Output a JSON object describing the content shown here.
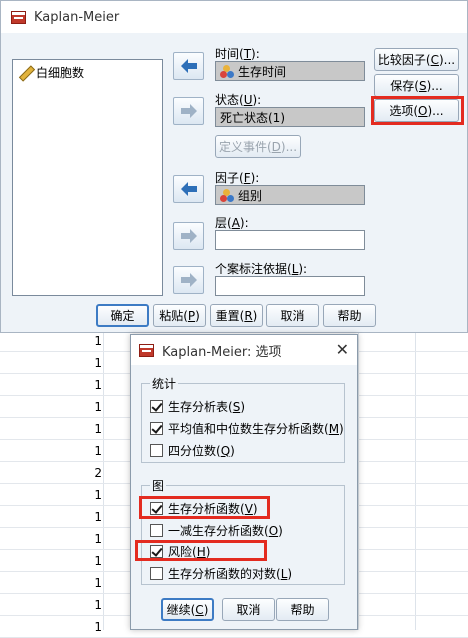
{
  "main_dialog": {
    "title": "Kaplan-Meier",
    "variable_list": [
      {
        "label": "白细胞数",
        "icon": "scale-pencil-icon"
      }
    ],
    "time": {
      "label_prefix": "时间(",
      "mnemonic": "T",
      "label_suffix": "):",
      "value": "生存时间"
    },
    "status": {
      "label_prefix": "状态(",
      "mnemonic": "U",
      "label_suffix": "):",
      "value": "死亡状态(1)"
    },
    "define_event": {
      "label_prefix": "定义事件(",
      "mnemonic": "D",
      "label_suffix": ")..."
    },
    "factor": {
      "label_prefix": "因子(",
      "mnemonic": "F",
      "label_suffix": "):",
      "value": "组别"
    },
    "strata": {
      "label_prefix": "层(",
      "mnemonic": "A",
      "label_suffix": "):",
      "value": ""
    },
    "case_label": {
      "label_prefix": "个案标注依据(",
      "mnemonic": "L",
      "label_suffix": "):",
      "value": ""
    },
    "side_buttons": {
      "compare": {
        "prefix": "比较因子(",
        "mnemonic": "C",
        "suffix": ")..."
      },
      "save": {
        "prefix": "保存(",
        "mnemonic": "S",
        "suffix": ")..."
      },
      "options": {
        "prefix": "选项(",
        "mnemonic": "O",
        "suffix": ")..."
      }
    },
    "bottom_buttons": {
      "ok": "确定",
      "paste": {
        "prefix": "粘贴(",
        "mnemonic": "P",
        "suffix": ")"
      },
      "reset": {
        "prefix": "重置(",
        "mnemonic": "R",
        "suffix": ")"
      },
      "cancel": "取消",
      "help": "帮助"
    }
  },
  "options_dialog": {
    "title": "Kaplan-Meier: 选项",
    "statistics_group": "统计",
    "statistics": [
      {
        "prefix": "生存分析表(",
        "mnemonic": "S",
        "suffix": ")",
        "checked": true
      },
      {
        "prefix": "平均值和中位数生存分析函数(",
        "mnemonic": "M",
        "suffix": ")",
        "checked": true
      },
      {
        "prefix": "四分位数(",
        "mnemonic": "Q",
        "suffix": ")",
        "checked": false
      }
    ],
    "plots_group": "图",
    "plots": [
      {
        "prefix": "生存分析函数(",
        "mnemonic": "V",
        "suffix": ")",
        "checked": true
      },
      {
        "prefix": "一减生存分析函数(",
        "mnemonic": "O",
        "suffix": ")",
        "checked": false
      },
      {
        "prefix": "风险(",
        "mnemonic": "H",
        "suffix": ")",
        "checked": true
      },
      {
        "prefix": "生存分析函数的对数(",
        "mnemonic": "L",
        "suffix": ")",
        "checked": false
      }
    ],
    "buttons": {
      "continue": {
        "prefix": "继续(",
        "mnemonic": "C",
        "suffix": ")"
      },
      "cancel": "取消",
      "help": "帮助"
    }
  },
  "sheet_values": [
    "1",
    "1",
    "1",
    "1",
    "1",
    "1",
    "2",
    "1",
    "1",
    "1",
    "1",
    "1",
    "1",
    "1"
  ],
  "colors": {
    "highlight": "#e32b20",
    "accent": "#3d7bc4"
  }
}
